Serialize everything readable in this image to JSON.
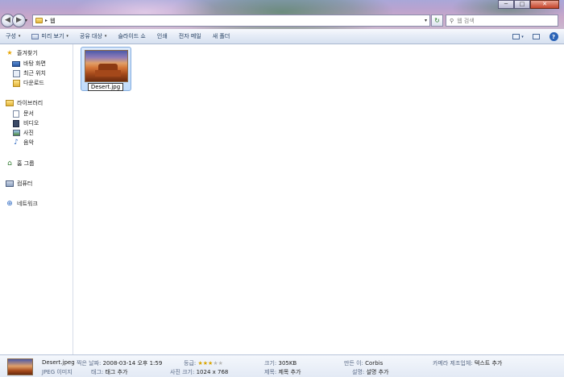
{
  "window": {
    "controls": {
      "minimize": "─",
      "maximize": "□",
      "close": "✕"
    }
  },
  "navigation": {
    "back_glyph": "◀",
    "forward_glyph": "▶",
    "recent_glyph": "▾"
  },
  "address_bar": {
    "separator": "▸",
    "path": "웹",
    "dropdown_glyph": "▾"
  },
  "refresh": {
    "glyph": "↻"
  },
  "search": {
    "glyph": "⚲",
    "placeholder": "웹 검색"
  },
  "command_bar": {
    "items": [
      {
        "label": "구성",
        "has_menu": true
      },
      {
        "label": "미리 보기",
        "has_menu": true
      },
      {
        "label": "공유 대상",
        "has_menu": true
      },
      {
        "label": "슬라이드 쇼",
        "has_menu": false
      },
      {
        "label": "인쇄",
        "has_menu": false
      },
      {
        "label": "전자 메일",
        "has_menu": false
      },
      {
        "label": "새 폴더",
        "has_menu": false
      }
    ],
    "caret": "▾",
    "help_glyph": "?"
  },
  "nav_pane": {
    "favorites": {
      "label": "즐겨찾기",
      "items": [
        "바탕 화면",
        "최근 위치",
        "다운로드"
      ]
    },
    "libraries": {
      "label": "라이브러리",
      "items": [
        "문서",
        "비디오",
        "사진",
        "음악"
      ]
    },
    "homegroup": "홈 그룹",
    "computer": "컴퓨터",
    "network": "네트워크"
  },
  "content": {
    "files": [
      {
        "name": "Desert.jpg",
        "editing_text": "Desert.jpg"
      }
    ]
  },
  "details": {
    "file_name": "Desert.jpeg",
    "file_type": "JPEG 이미지",
    "date_taken_label": "찍은 날짜:",
    "date_taken": "2008-03-14 오후 1:59",
    "tags_label": "태그:",
    "tags": "태그 추가",
    "rating_label": "등급:",
    "rating": 3,
    "rating_max": 5,
    "dimensions_label": "사진 크기:",
    "dimensions": "1024 x 768",
    "size_label": "크기:",
    "size": "305KB",
    "title_label": "제목:",
    "title": "제목 추가",
    "authors_label": "만든 이:",
    "authors": "Corbis",
    "comments_label": "설명:",
    "comments": "설명 추가",
    "camera_maker_label": "카메라 제조업체:",
    "camera_maker": "텍스트 추가"
  },
  "colors": {
    "accent": "#1e395b",
    "selection_fill": "#c1dcfc",
    "selection_border": "#84acdd",
    "star_on": "#d9a400"
  }
}
